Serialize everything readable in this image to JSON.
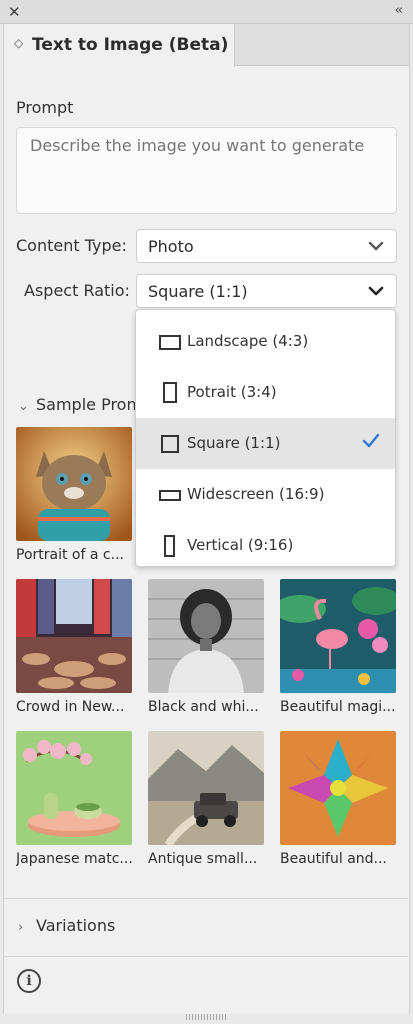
{
  "panel": {
    "tab_title": "Text to Image (Beta)"
  },
  "prompt": {
    "label": "Prompt",
    "placeholder": "Describe the image you want to generate"
  },
  "content_type": {
    "label": "Content Type:",
    "value": "Photo"
  },
  "aspect_ratio": {
    "label": "Aspect Ratio:",
    "value": "Square (1:1)",
    "options": [
      {
        "label": "Landscape (4:3)",
        "icon": "landscape-frame-icon",
        "selected": false
      },
      {
        "label": "Potrait (3:4)",
        "icon": "portrait-frame-icon",
        "selected": false
      },
      {
        "label": "Square (1:1)",
        "icon": "square-frame-icon",
        "selected": true
      },
      {
        "label": "Widescreen (16:9)",
        "icon": "widescreen-frame-icon",
        "selected": false
      },
      {
        "label": "Vertical (9:16)",
        "icon": "vertical-frame-icon",
        "selected": false
      }
    ]
  },
  "sample_prompts": {
    "heading": "Sample Pron",
    "items": [
      {
        "caption": "Portrait of a c...",
        "image": "kitten-in-sweater"
      },
      {
        "caption": "Crowd in New...",
        "image": "city-crowd"
      },
      {
        "caption": "Black and whi...",
        "image": "woman-portrait"
      },
      {
        "caption": "Beautiful magi...",
        "image": "flamingo-jungle"
      },
      {
        "caption": "Japanese matc...",
        "image": "matcha-tea-set"
      },
      {
        "caption": "Antique small...",
        "image": "antique-car"
      },
      {
        "caption": "Beautiful and...",
        "image": "origami-mandala"
      }
    ]
  },
  "variations": {
    "heading": "Variations"
  },
  "colors": {
    "accent": "#2f7ad9",
    "panel_bg": "#f0f0f0"
  }
}
